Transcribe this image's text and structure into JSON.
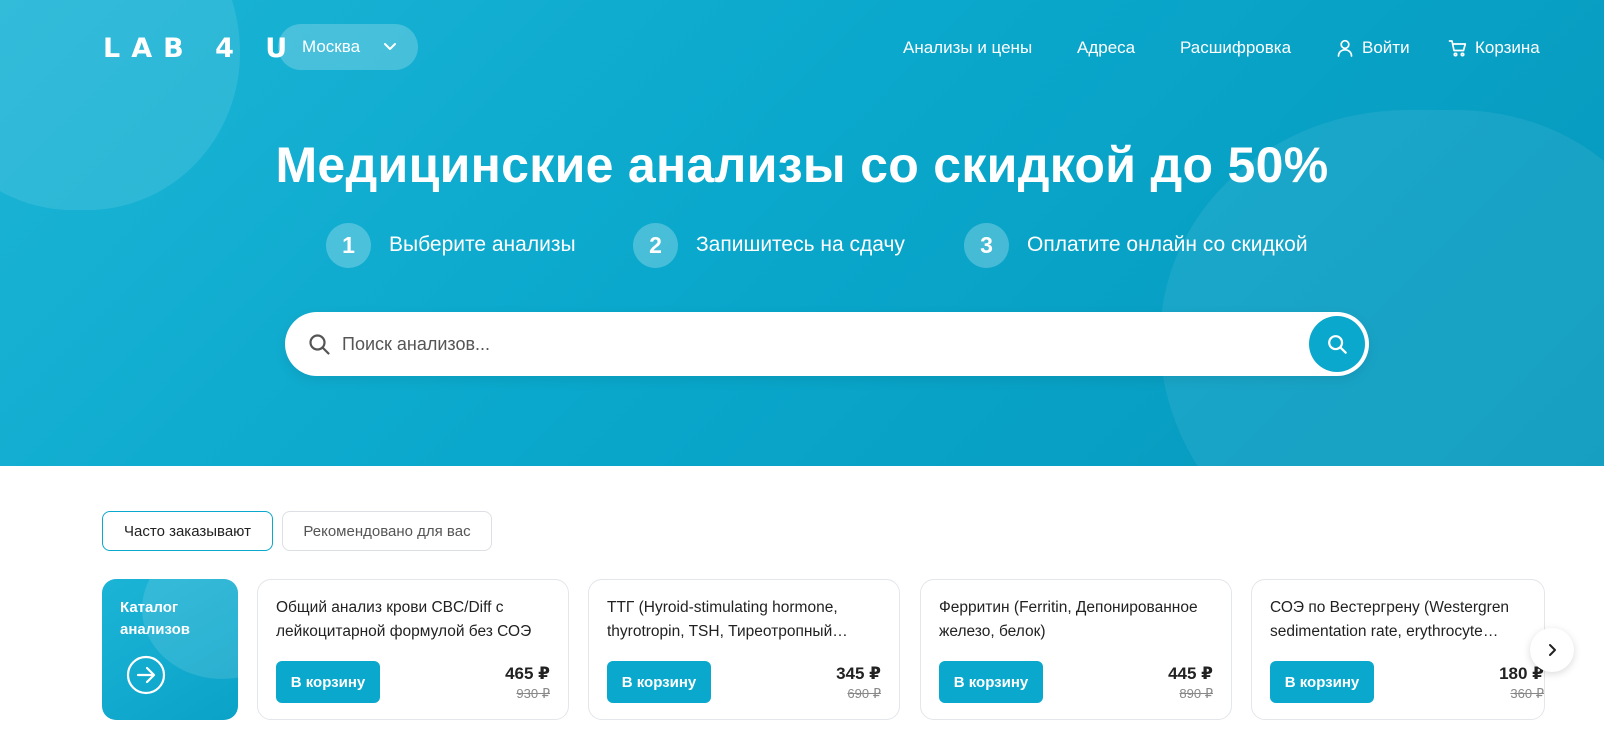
{
  "header": {
    "logo": "LAB 4 U",
    "city": "Москва",
    "nav": {
      "tests": "Анализы и цены",
      "addresses": "Адреса",
      "decoding": "Расшифровка",
      "login": "Войти",
      "cart": "Корзина"
    }
  },
  "hero": {
    "title": "Медицинские анализы со скидкой до 50%",
    "steps": [
      {
        "num": "1",
        "label": "Выберите анализы"
      },
      {
        "num": "2",
        "label": "Запишитесь на сдачу"
      },
      {
        "num": "3",
        "label": "Оплатите онлайн со скидкой"
      }
    ],
    "search": {
      "placeholder": "Поиск анализов...",
      "value": ""
    }
  },
  "tabs": [
    {
      "label": "Часто заказывают",
      "active": true
    },
    {
      "label": "Рекомендовано для вас",
      "active": false
    }
  ],
  "catalog": {
    "label": "Каталог анализов"
  },
  "cards": [
    {
      "name": "Общий анализ крови CBC/Diff с лейкоцитарной формулой без СОЭ",
      "button": "В корзину",
      "price": "465 ₽",
      "old_price": "930 ₽"
    },
    {
      "name": "ТТГ (Hyroid-stimulating hormone, thyrotropin, TSH, Тиреотропный гормон)",
      "button": "В корзину",
      "price": "345 ₽",
      "old_price": "690 ₽"
    },
    {
      "name": "Ферритин (Ferritin, Депонированное железо, белок)",
      "button": "В корзину",
      "price": "445 ₽",
      "old_price": "890 ₽"
    },
    {
      "name": "СОЭ по Вестергрену (Westergren sedimentation rate, erythrocyte sedimentation rate)",
      "button": "В корзину",
      "price": "180 ₽",
      "old_price": "360 ₽"
    }
  ],
  "colors": {
    "accent": "#0aa8cc",
    "hero_bg": "#0aa8cc"
  }
}
